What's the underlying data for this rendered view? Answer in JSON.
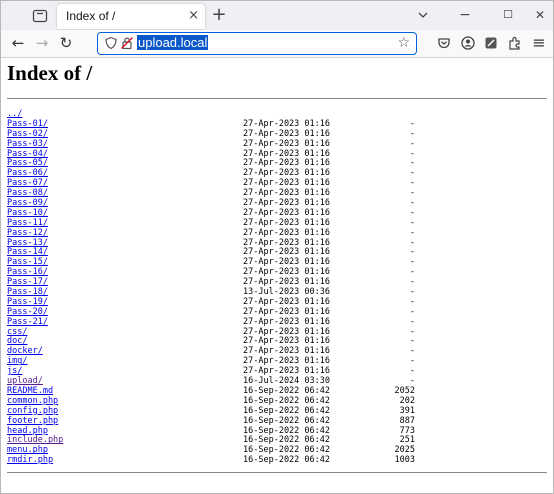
{
  "browser": {
    "tab_title": "Index of /",
    "tab_close": "×",
    "new_tab": "+",
    "url": "upload.local",
    "star": "☆",
    "back": "←",
    "forward": "→",
    "reload": "↻",
    "menu": "≡",
    "minimize": "−",
    "maximize": "☐",
    "close": "✕"
  },
  "page": {
    "heading": "Index of /",
    "entries": [
      {
        "name": "../",
        "date": "",
        "size": "",
        "visited": false
      },
      {
        "name": "Pass-01/",
        "date": "27-Apr-2023 01:16",
        "size": "-",
        "visited": false
      },
      {
        "name": "Pass-02/",
        "date": "27-Apr-2023 01:16",
        "size": "-",
        "visited": false
      },
      {
        "name": "Pass-03/",
        "date": "27-Apr-2023 01:16",
        "size": "-",
        "visited": false
      },
      {
        "name": "Pass-04/",
        "date": "27-Apr-2023 01:16",
        "size": "-",
        "visited": false
      },
      {
        "name": "Pass-05/",
        "date": "27-Apr-2023 01:16",
        "size": "-",
        "visited": false
      },
      {
        "name": "Pass-06/",
        "date": "27-Apr-2023 01:16",
        "size": "-",
        "visited": false
      },
      {
        "name": "Pass-07/",
        "date": "27-Apr-2023 01:16",
        "size": "-",
        "visited": false
      },
      {
        "name": "Pass-08/",
        "date": "27-Apr-2023 01:16",
        "size": "-",
        "visited": false
      },
      {
        "name": "Pass-09/",
        "date": "27-Apr-2023 01:16",
        "size": "-",
        "visited": false
      },
      {
        "name": "Pass-10/",
        "date": "27-Apr-2023 01:16",
        "size": "-",
        "visited": false
      },
      {
        "name": "Pass-11/",
        "date": "27-Apr-2023 01:16",
        "size": "-",
        "visited": false
      },
      {
        "name": "Pass-12/",
        "date": "27-Apr-2023 01:16",
        "size": "-",
        "visited": false
      },
      {
        "name": "Pass-13/",
        "date": "27-Apr-2023 01:16",
        "size": "-",
        "visited": false
      },
      {
        "name": "Pass-14/",
        "date": "27-Apr-2023 01:16",
        "size": "-",
        "visited": false
      },
      {
        "name": "Pass-15/",
        "date": "27-Apr-2023 01:16",
        "size": "-",
        "visited": false
      },
      {
        "name": "Pass-16/",
        "date": "27-Apr-2023 01:16",
        "size": "-",
        "visited": false
      },
      {
        "name": "Pass-17/",
        "date": "27-Apr-2023 01:16",
        "size": "-",
        "visited": false
      },
      {
        "name": "Pass-18/",
        "date": "13-Jul-2023 00:36",
        "size": "-",
        "visited": false
      },
      {
        "name": "Pass-19/",
        "date": "27-Apr-2023 01:16",
        "size": "-",
        "visited": false
      },
      {
        "name": "Pass-20/",
        "date": "27-Apr-2023 01:16",
        "size": "-",
        "visited": false
      },
      {
        "name": "Pass-21/",
        "date": "27-Apr-2023 01:16",
        "size": "-",
        "visited": false
      },
      {
        "name": "css/",
        "date": "27-Apr-2023 01:16",
        "size": "-",
        "visited": false
      },
      {
        "name": "doc/",
        "date": "27-Apr-2023 01:16",
        "size": "-",
        "visited": false
      },
      {
        "name": "docker/",
        "date": "27-Apr-2023 01:16",
        "size": "-",
        "visited": false
      },
      {
        "name": "img/",
        "date": "27-Apr-2023 01:16",
        "size": "-",
        "visited": false
      },
      {
        "name": "js/",
        "date": "27-Apr-2023 01:16",
        "size": "-",
        "visited": false
      },
      {
        "name": "upload/",
        "date": "16-Jul-2024 03:30",
        "size": "-",
        "visited": true
      },
      {
        "name": "README.md",
        "date": "16-Sep-2022 06:42",
        "size": "2052",
        "visited": false
      },
      {
        "name": "common.php",
        "date": "16-Sep-2022 06:42",
        "size": "202",
        "visited": false
      },
      {
        "name": "config.php",
        "date": "16-Sep-2022 06:42",
        "size": "391",
        "visited": false
      },
      {
        "name": "footer.php",
        "date": "16-Sep-2022 06:42",
        "size": "887",
        "visited": false
      },
      {
        "name": "head.php",
        "date": "16-Sep-2022 06:42",
        "size": "773",
        "visited": false
      },
      {
        "name": "include.php",
        "date": "16-Sep-2022 06:42",
        "size": "251",
        "visited": true
      },
      {
        "name": "menu.php",
        "date": "16-Sep-2022 06:42",
        "size": "2025",
        "visited": false
      },
      {
        "name": "rmdir.php",
        "date": "16-Sep-2022 06:42",
        "size": "1003",
        "visited": false
      }
    ]
  }
}
